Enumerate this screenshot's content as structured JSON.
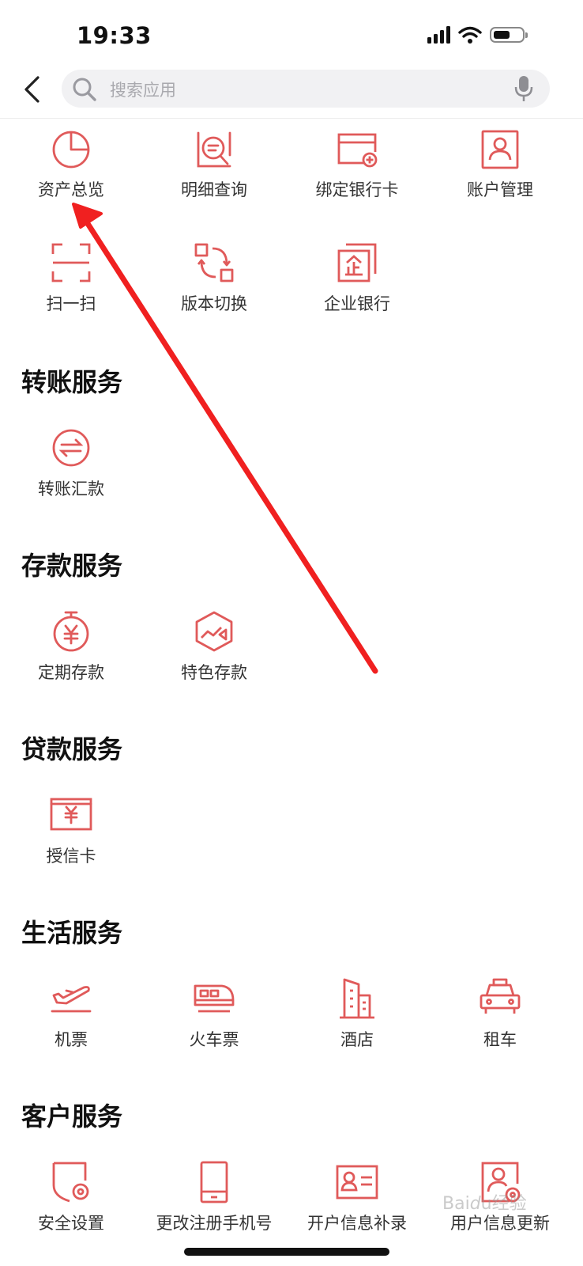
{
  "status_bar": {
    "time": "19:33"
  },
  "search": {
    "placeholder": "搜索应用"
  },
  "quick_apps": [
    {
      "label": "资产总览",
      "icon": "pie-chart-icon"
    },
    {
      "label": "明细查询",
      "icon": "search-document-icon"
    },
    {
      "label": "绑定银行卡",
      "icon": "add-card-icon"
    },
    {
      "label": "账户管理",
      "icon": "user-profile-icon"
    },
    {
      "label": "扫一扫",
      "icon": "scan-icon"
    },
    {
      "label": "版本切换",
      "icon": "switch-icon"
    },
    {
      "label": "企业银行",
      "icon": "enterprise-bank-icon"
    }
  ],
  "sections": [
    {
      "title": "转账服务",
      "items": [
        {
          "label": "转账汇款",
          "icon": "transfer-icon"
        }
      ]
    },
    {
      "title": "存款服务",
      "items": [
        {
          "label": "定期存款",
          "icon": "fixed-deposit-icon"
        },
        {
          "label": "特色存款",
          "icon": "featured-deposit-icon"
        }
      ]
    },
    {
      "title": "贷款服务",
      "items": [
        {
          "label": "授信卡",
          "icon": "credit-card-icon"
        }
      ]
    },
    {
      "title": "生活服务",
      "items": [
        {
          "label": "机票",
          "icon": "plane-icon"
        },
        {
          "label": "火车票",
          "icon": "train-icon"
        },
        {
          "label": "酒店",
          "icon": "hotel-icon"
        },
        {
          "label": "租车",
          "icon": "car-icon"
        }
      ]
    },
    {
      "title": "客户服务",
      "items": [
        {
          "label": "安全设置",
          "icon": "security-settings-icon"
        },
        {
          "label": "更改注册手机号",
          "icon": "phone-icon"
        },
        {
          "label": "开户信息补录",
          "icon": "id-card-icon"
        },
        {
          "label": "用户信息更新",
          "icon": "user-update-icon"
        }
      ]
    }
  ],
  "colors": {
    "accent": "#e05a5a",
    "annotation_arrow": "#f02020"
  }
}
